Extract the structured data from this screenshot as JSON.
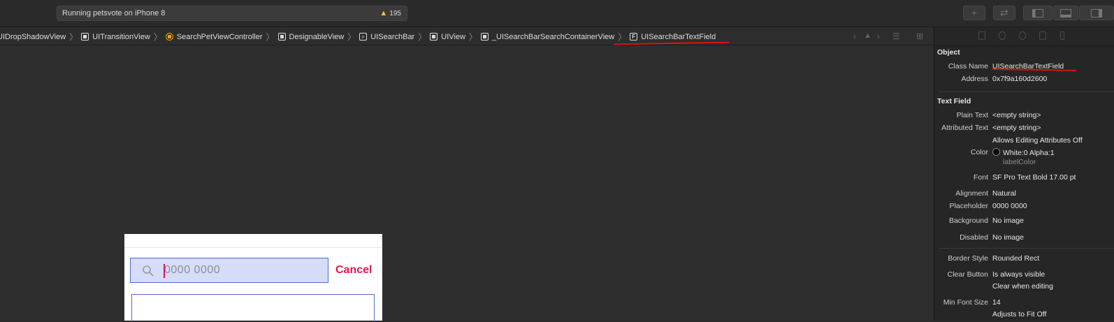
{
  "toolbar": {
    "status": "Running petsvote on iPhone 8",
    "warning_count": "195",
    "buttons": [
      "add-icon",
      "swap-icon",
      "left-panel-icon",
      "bottom-panel-icon",
      "right-panel-icon"
    ]
  },
  "jumpbar": {
    "crumbs": [
      {
        "label": "UIDropShadowView",
        "icon": "none"
      },
      {
        "label": "UITransitionView",
        "icon": "view-icon"
      },
      {
        "label": "SearchPetViewController",
        "icon": "view-controller-icon"
      },
      {
        "label": "DesignableView",
        "icon": "view-icon"
      },
      {
        "label": "UISearchBar",
        "icon": "search-bar-icon"
      },
      {
        "label": "UIView",
        "icon": "view-icon"
      },
      {
        "label": "_UISearchBarSearchContainerView",
        "icon": "view-icon"
      },
      {
        "label": "UISearchBarTextField",
        "icon": "text-field-icon"
      }
    ]
  },
  "canvas": {
    "search_placeholder": "0000 0000",
    "cancel_label": "Cancel"
  },
  "inspector": {
    "object_header": "Object",
    "class_name_label": "Class Name",
    "class_name_value": "UISearchBarTextField",
    "address_label": "Address",
    "address_value": "0x7f9a160d2600",
    "text_field_header": "Text Field",
    "plain_text_label": "Plain Text",
    "plain_text_value": "<empty string>",
    "attributed_text_label": "Attributed Text",
    "attributed_text_value": "<empty string>",
    "allows_editing_value": "Allows Editing Attributes Off",
    "color_label": "Color",
    "color_value": "White:0 Alpha:1",
    "color_sub": "labelColor",
    "font_label": "Font",
    "font_value": "SF Pro Text Bold 17.00 pt",
    "alignment_label": "Alignment",
    "alignment_value": "Natural",
    "placeholder_label": "Placeholder",
    "placeholder_value": "0000 0000",
    "background_label": "Background",
    "background_value": "No image",
    "disabled_label": "Disabled",
    "disabled_value": "No image",
    "border_style_label": "Border Style",
    "border_style_value": "Rounded Rect",
    "clear_button_label": "Clear Button",
    "clear_button_value": "Is always visible",
    "clear_when_editing_value": "Clear when editing",
    "min_font_label": "Min Font Size",
    "min_font_value": "14",
    "adjusts_value": "Adjusts to Fit Off"
  }
}
